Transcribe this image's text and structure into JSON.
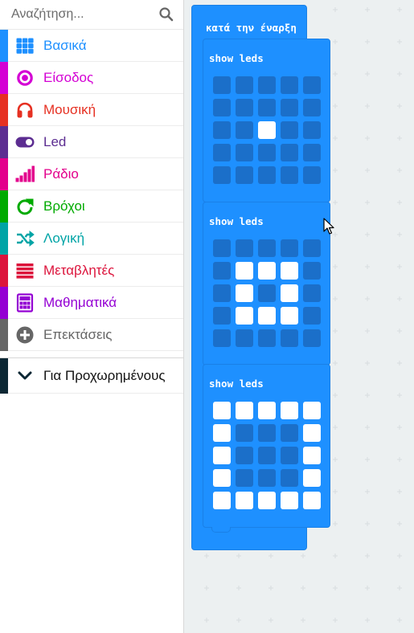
{
  "toolbox": {
    "search": {
      "placeholder": "Αναζήτηση..."
    },
    "categories": [
      {
        "label": "Βασικά",
        "color": "#1e90ff",
        "icon": "grid-icon"
      },
      {
        "label": "Είσοδος",
        "color": "#d400d4",
        "icon": "target-icon"
      },
      {
        "label": "Μουσική",
        "color": "#e63022",
        "icon": "headphones-icon"
      },
      {
        "label": "Led",
        "color": "#5c2d91",
        "icon": "toggle-icon"
      },
      {
        "label": "Ράδιο",
        "color": "#e3008c",
        "icon": "signal-bars-icon"
      },
      {
        "label": "Βρόχοι",
        "color": "#00aa00",
        "icon": "loop-arrow-icon"
      },
      {
        "label": "Λογική",
        "color": "#00a4a6",
        "icon": "shuffle-icon"
      },
      {
        "label": "Μεταβλητές",
        "color": "#dc143c",
        "icon": "lines-icon"
      },
      {
        "label": "Μαθηματικά",
        "color": "#9400d3",
        "icon": "calculator-icon"
      },
      {
        "label": "Επεκτάσεις",
        "color": "#666666",
        "icon": "plus-circle-icon"
      }
    ],
    "advanced": {
      "label": "Για Προχωρημένους",
      "color": "#0c2734",
      "icon": "chevron-down-icon"
    }
  },
  "workspace": {
    "hat_block": {
      "label": "κατά την έναρξη",
      "color": "#1e90ff"
    },
    "blocks": [
      {
        "label": "show leds",
        "leds": [
          [
            0,
            0,
            0,
            0,
            0
          ],
          [
            0,
            0,
            0,
            0,
            0
          ],
          [
            0,
            0,
            1,
            0,
            0
          ],
          [
            0,
            0,
            0,
            0,
            0
          ],
          [
            0,
            0,
            0,
            0,
            0
          ]
        ]
      },
      {
        "label": "show leds",
        "leds": [
          [
            0,
            0,
            0,
            0,
            0
          ],
          [
            0,
            1,
            1,
            1,
            0
          ],
          [
            0,
            1,
            0,
            1,
            0
          ],
          [
            0,
            1,
            1,
            1,
            0
          ],
          [
            0,
            0,
            0,
            0,
            0
          ]
        ]
      },
      {
        "label": "show leds",
        "leds": [
          [
            1,
            1,
            1,
            1,
            1
          ],
          [
            1,
            0,
            0,
            0,
            1
          ],
          [
            1,
            0,
            0,
            0,
            1
          ],
          [
            1,
            0,
            0,
            0,
            1
          ],
          [
            1,
            1,
            1,
            1,
            1
          ]
        ]
      }
    ],
    "led_on_color": "#ffffff",
    "led_off_color": "#1b6fc9"
  }
}
